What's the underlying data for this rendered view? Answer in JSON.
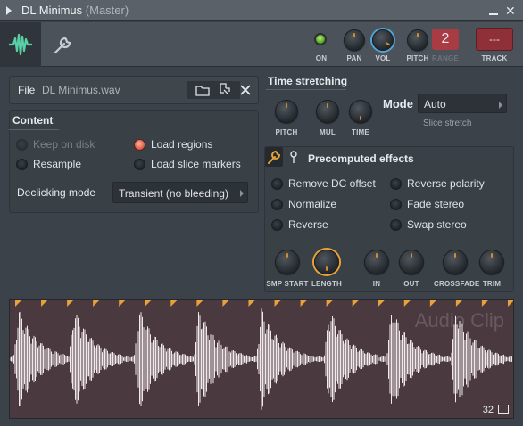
{
  "window": {
    "title": "DL Minimus",
    "subtitle": "(Master)",
    "minimize_icon": "minimize-icon",
    "close_icon": "close-icon"
  },
  "toolbar": {
    "knobs": [
      {
        "label": "ON"
      },
      {
        "label": "PAN"
      },
      {
        "label": "VOL"
      },
      {
        "label": "PITCH"
      },
      {
        "label": "RANGE"
      },
      {
        "label": "TRACK"
      }
    ],
    "range_value": "2",
    "track_value": "---",
    "accent_color": "#e9a23b",
    "active_color": "#52a3d8"
  },
  "file": {
    "label": "File",
    "value": "DL Minimus.wav"
  },
  "content": {
    "title": "Content",
    "options": [
      {
        "label": "Keep on disk",
        "selected": false,
        "disabled": true
      },
      {
        "label": "Load regions",
        "selected": true,
        "disabled": false
      },
      {
        "label": "Resample",
        "selected": false,
        "disabled": false
      },
      {
        "label": "Load slice markers",
        "selected": false,
        "disabled": false
      }
    ],
    "declicking_label": "Declicking mode",
    "declicking_value": "Transient (no bleeding)"
  },
  "time_stretching": {
    "title": "Time stretching",
    "knobs": [
      {
        "label": "PITCH"
      },
      {
        "label": "MUL"
      },
      {
        "label": "TIME"
      }
    ],
    "mode_label": "Mode",
    "mode_value": "Auto",
    "mode_hint": "Slice stretch"
  },
  "precomputed": {
    "title": "Precomputed effects",
    "options": [
      {
        "label": "Remove DC offset"
      },
      {
        "label": "Reverse polarity"
      },
      {
        "label": "Normalize"
      },
      {
        "label": "Fade stereo"
      },
      {
        "label": "Reverse"
      },
      {
        "label": "Swap stereo"
      }
    ],
    "knobs": [
      {
        "label": "SMP START"
      },
      {
        "label": "LENGTH"
      },
      {
        "label": "IN"
      },
      {
        "label": "OUT"
      },
      {
        "label": "CROSSFADE"
      },
      {
        "label": "TRIM"
      }
    ]
  },
  "waveform": {
    "watermark": "Audio Clip",
    "slice_count": "32",
    "marker_count": 20
  }
}
